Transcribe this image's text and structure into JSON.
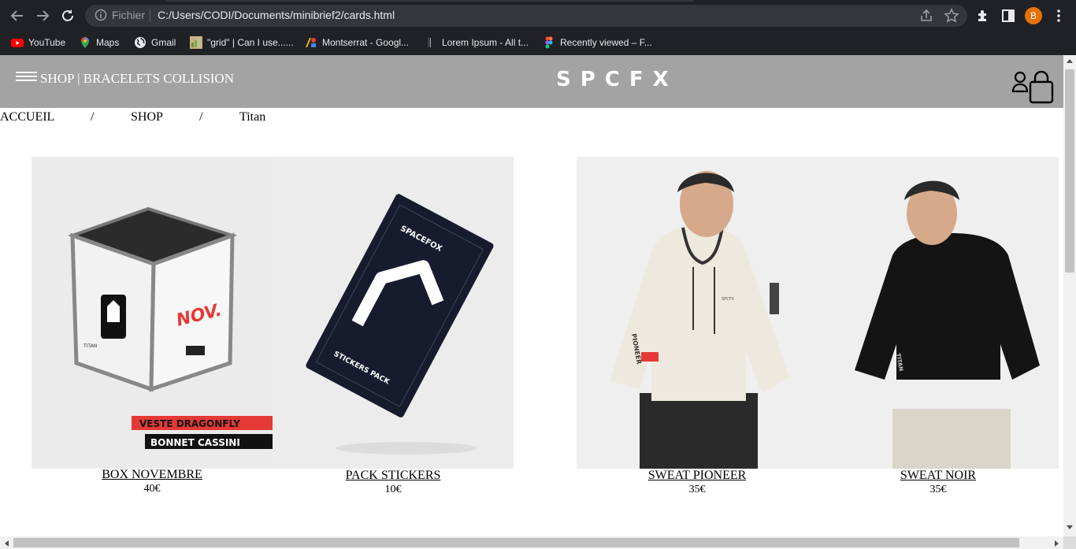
{
  "browser": {
    "url_prefix": "Fichier",
    "url": "C:/Users/CODI/Documents/minibrief2/cards.html",
    "profile_initial": "B",
    "bookmarks": [
      {
        "label": "YouTube",
        "icon": "youtube-icon"
      },
      {
        "label": "Maps",
        "icon": "maps-icon"
      },
      {
        "label": "Gmail",
        "icon": "globe-icon"
      },
      {
        "label": "\"grid\" | Can I use......",
        "icon": "caniuse-icon"
      },
      {
        "label": "Montserrat - Googl...",
        "icon": "google-fonts-icon"
      },
      {
        "label": "Lorem Ipsum - All t...",
        "icon": "lorem-ipsum-icon"
      },
      {
        "label": "Recently viewed – F...",
        "icon": "figma-icon"
      }
    ]
  },
  "header": {
    "title": "SHOP | BRACELETS COLLISION",
    "logo": "SPCFX"
  },
  "breadcrumb": {
    "items": [
      "ACCUEIL",
      "SHOP",
      "Titan"
    ],
    "separator": "/"
  },
  "products": [
    {
      "name": "BOX NOVEMBRE",
      "price": "40€",
      "box_text": "NOV.",
      "box_brand": "TITAN",
      "labels": [
        "VESTE DRAGONFLY",
        "BONNET CASSINI"
      ]
    },
    {
      "name": "PACK STICKERS",
      "price": "10€",
      "pack_brand": "SPACEFOX",
      "pack_text": "STICKERS PACK"
    },
    {
      "name": "SWEAT PIONEER",
      "price": "35€",
      "sleeve_text": "PIONEER",
      "chest_text": "SPCFX"
    },
    {
      "name": "SWEAT NOIR",
      "price": "35€",
      "sleeve_text": "TITAN"
    }
  ],
  "colors": {
    "header_bg": "#a3a3a3",
    "chrome_bg": "#202124",
    "accent_red": "#e53935",
    "profile": "#e8710a"
  }
}
